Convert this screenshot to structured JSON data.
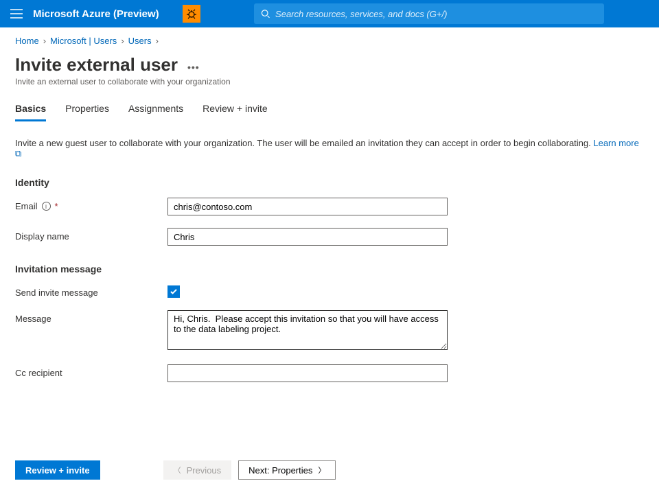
{
  "header": {
    "brand": "Microsoft Azure (Preview)",
    "search_placeholder": "Search resources, services, and docs (G+/)"
  },
  "breadcrumb": {
    "items": [
      "Home",
      "Microsoft | Users",
      "Users"
    ]
  },
  "page": {
    "title": "Invite external user",
    "subtitle": "Invite an external user to collaborate with your organization"
  },
  "tabs": [
    {
      "label": "Basics",
      "active": true
    },
    {
      "label": "Properties",
      "active": false
    },
    {
      "label": "Assignments",
      "active": false
    },
    {
      "label": "Review + invite",
      "active": false
    }
  ],
  "intro": {
    "text": "Invite a new guest user to collaborate with your organization. The user will be emailed an invitation they can accept in order to begin collaborating. ",
    "learn_more": "Learn more"
  },
  "identity": {
    "heading": "Identity",
    "email_label": "Email",
    "email_value": "chris@contoso.com",
    "display_name_label": "Display name",
    "display_name_value": "Chris"
  },
  "invitation": {
    "heading": "Invitation message",
    "send_label": "Send invite message",
    "send_checked": true,
    "message_label": "Message",
    "message_value": "Hi, Chris.  Please accept this invitation so that you will have access to the data labeling project.",
    "cc_label": "Cc recipient",
    "cc_value": ""
  },
  "footer": {
    "review": "Review + invite",
    "previous": "Previous",
    "next": "Next: Properties"
  }
}
